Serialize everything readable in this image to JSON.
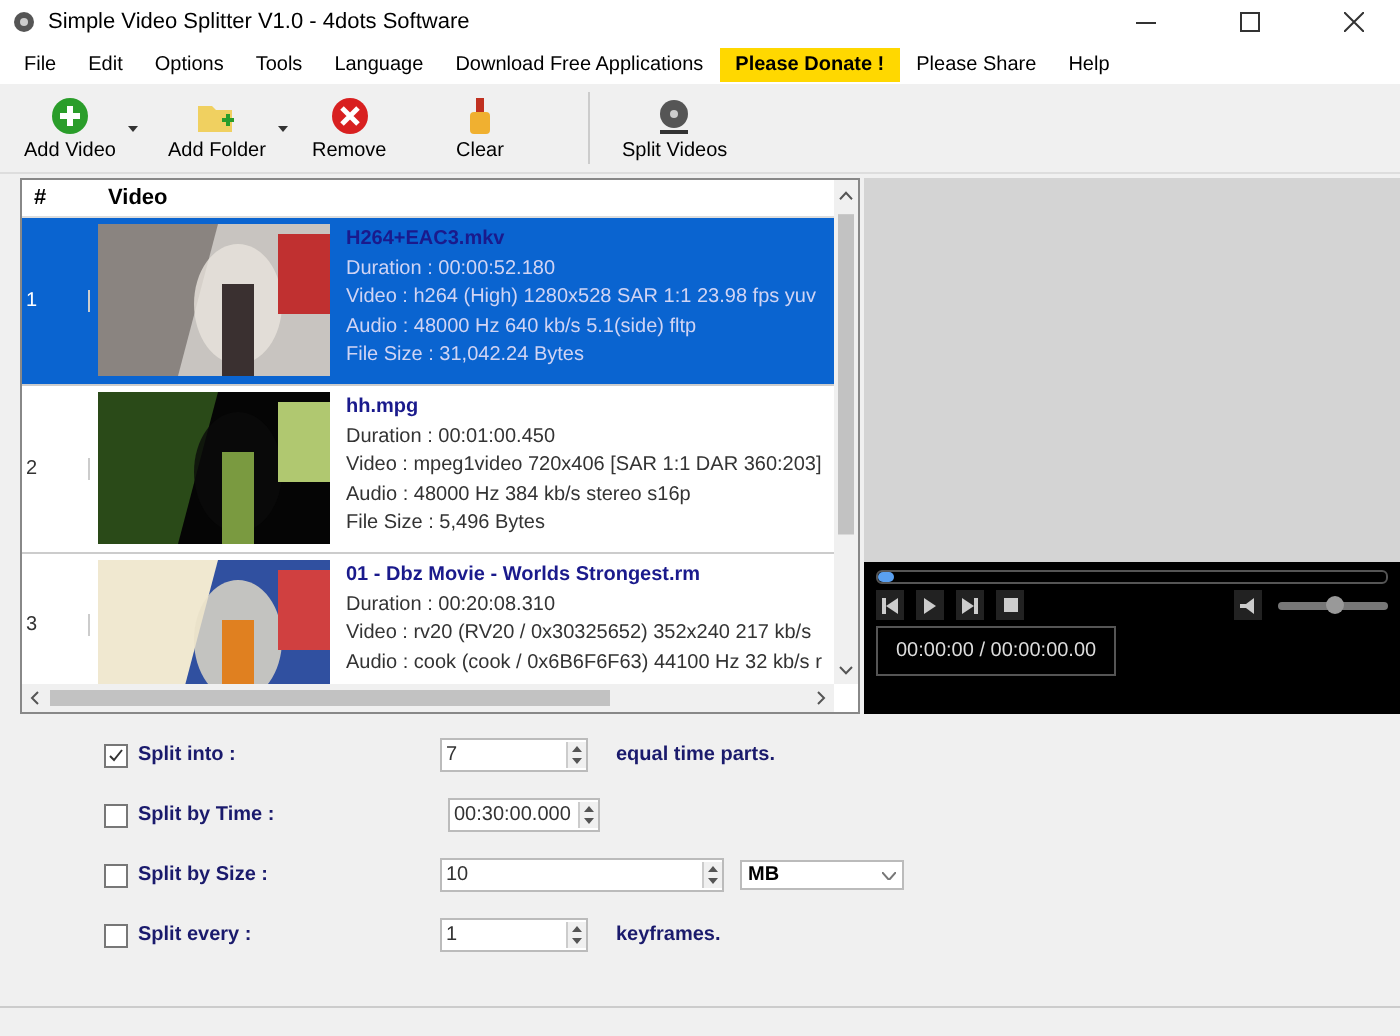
{
  "window": {
    "title": "Simple Video Splitter V1.0 - 4dots Software"
  },
  "menu": [
    {
      "label": "File",
      "kind": "plain"
    },
    {
      "label": "Edit",
      "kind": "plain"
    },
    {
      "label": "Options",
      "kind": "plain"
    },
    {
      "label": "Tools",
      "kind": "plain"
    },
    {
      "label": "Language",
      "kind": "plain"
    },
    {
      "label": "Download Free Applications",
      "kind": "plain"
    },
    {
      "label": "Please Donate !",
      "kind": "highlight"
    },
    {
      "label": "Please Share",
      "kind": "plain"
    },
    {
      "label": "Help",
      "kind": "plain"
    }
  ],
  "toolbar": [
    {
      "label": "Add Video",
      "kind": "add",
      "dropdown": true
    },
    {
      "label": "Add Folder",
      "kind": "folder",
      "dropdown": true
    },
    {
      "label": "Remove",
      "kind": "remove",
      "dropdown": false
    },
    {
      "label": "Clear",
      "kind": "clear",
      "dropdown": false
    },
    {
      "label": "Split Videos",
      "kind": "split",
      "dropdown": false
    }
  ],
  "table": {
    "columns": [
      "#",
      "Video"
    ],
    "rows": [
      {
        "number": "1",
        "selected": true,
        "kind": "picture",
        "filename": "H264+EAC3.mkv",
        "details": [
          "Duration : 00:00:52.180",
          "Video : h264 (High) 1280x528 SAR 1:1 23.98 fps yuv",
          "Audio : 48000 Hz 640 kb/s 5.1(side) fltp",
          "File Size : 31,042.24 Bytes"
        ]
      },
      {
        "number": "2",
        "selected": false,
        "kind": "picture",
        "filename": "hh.mpg",
        "details": [
          "Duration : 00:01:00.450",
          "Video : mpeg1video 720x406 [SAR 1:1 DAR 360:203]",
          "Audio :  48000 Hz 384 kb/s stereo s16p",
          "File Size : 5,496 Bytes"
        ]
      },
      {
        "number": "3",
        "selected": false,
        "kind": "picture",
        "filename": "01 - Dbz Movie - Worlds Strongest.rm",
        "details": [
          "Duration : 00:20:08.310",
          "Video : rv20 (RV20 / 0x30325652) 352x240 217 kb/s",
          "Audio : cook (cook / 0x6B6F6F63) 44100 Hz 32 kb/s r"
        ]
      }
    ]
  },
  "player": {
    "progress": {
      "level": 0.03
    },
    "volume": {
      "level": 0.5
    },
    "time": "00:00:00 / 00:00:00.00"
  },
  "options": [
    {
      "kind": "spin",
      "checked": true,
      "label": "Split into :",
      "value": "7",
      "suffix": "equal time parts."
    },
    {
      "kind": "time",
      "checked": false,
      "label": "Split by Time :",
      "value": "00:30:00.000"
    },
    {
      "kind": "size",
      "checked": false,
      "label": "Split by Size :",
      "value": "10",
      "unit": "MB"
    },
    {
      "kind": "spin",
      "checked": false,
      "label": "Split every :",
      "value": "1",
      "suffix": "keyframes."
    }
  ]
}
